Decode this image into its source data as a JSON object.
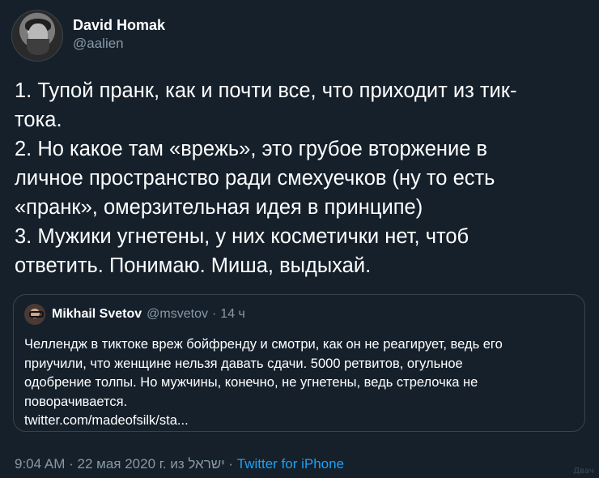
{
  "author": {
    "display_name": "David Homak",
    "handle": "@aalien"
  },
  "tweet": {
    "lines": [
      "1. Тупой пранк, как и почти все, что приходит из тик-",
      "тока.",
      "2. Но какое там «врежь», это грубое вторжение в",
      "личное пространство ради смехуечков (ну то есть",
      "«пранк», омерзительная идея в принципе)",
      "3. Мужики угнетены, у них косметички нет, чтоб",
      "ответить. Понимаю. Миша, выдыхай."
    ]
  },
  "quoted": {
    "display_name": "Mikhail Svetov",
    "handle": "@msvetov",
    "separator": "·",
    "time": "14 ч",
    "lines": [
      "Челлендж в тиктоке вреж бойфренду и смотри, как он не реагирует, ведь его",
      "приучили, что женщине нельзя давать сдачи. 5000 ретвитов, огульное",
      "одобрение толпы. Но мужчины, конечно, не угнетены, ведь стрелочка не",
      "поворачивается.",
      "twitter.com/madeofsilk/sta..."
    ]
  },
  "footer": {
    "time": "9:04 AM",
    "date": "22 мая 2020 г.",
    "from_word": "из",
    "location": "ישראל",
    "sep1": "·",
    "sep2": "·",
    "source": "Twitter for iPhone"
  },
  "watermark": "Двач"
}
